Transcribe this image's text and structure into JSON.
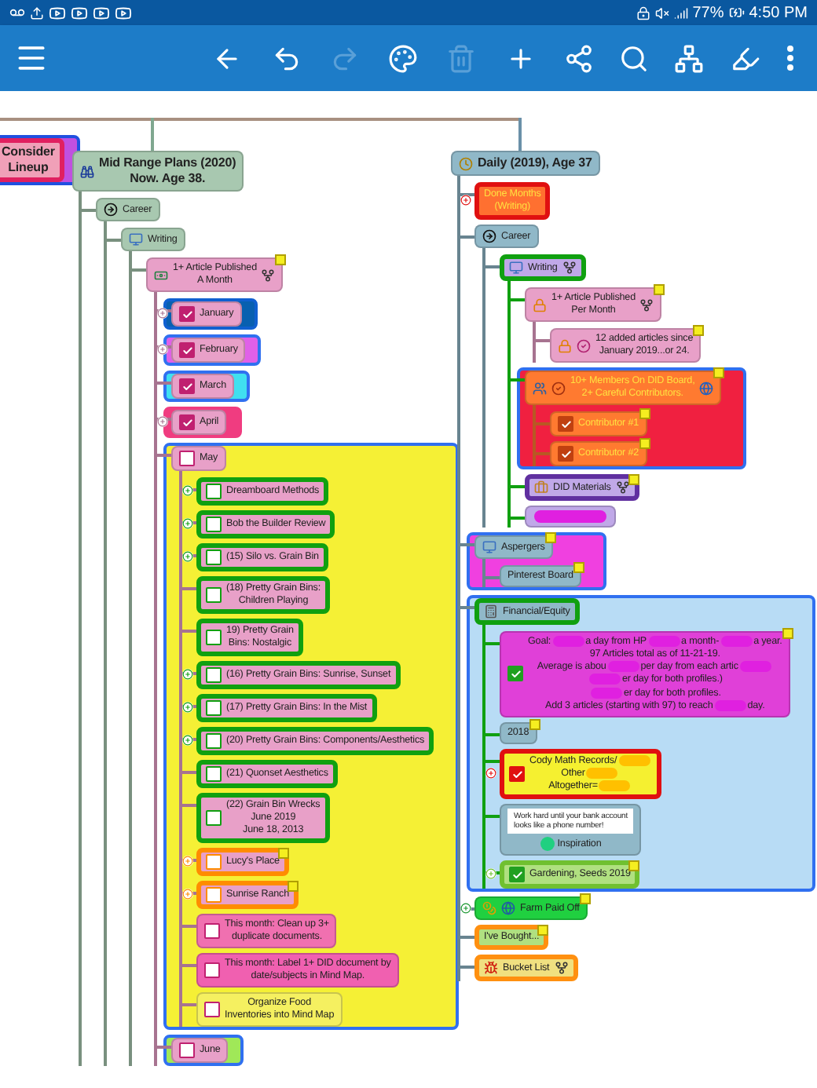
{
  "status_bar": {
    "battery": "77%",
    "time": "4:50 PM"
  },
  "toolbar": {
    "buttons": [
      {
        "disabled": false
      },
      {
        "disabled": false
      },
      {
        "disabled": false
      },
      {
        "disabled": true
      },
      {
        "disabled": false
      },
      {
        "disabled": true
      },
      {
        "disabled": false
      },
      {
        "disabled": false
      },
      {
        "disabled": false
      },
      {
        "disabled": false
      },
      {
        "disabled": false
      },
      {
        "disabled": false
      }
    ]
  },
  "branches": [
    {
      "label": "Consider\nLineup",
      "color": "#f0a0b8",
      "outline": {
        "color": "#e02060"
      },
      "boundary": {
        "color": "#c050e0",
        "edge": {
          "color": "#2050e0"
        }
      }
    },
    {
      "label": "Mid Range Plans (2020)\nNow. Age 38.",
      "color": "#a8c8b0",
      "children": [
        {
          "label": "Career",
          "color": "#a8c8b0",
          "children": [
            {
              "label": "Writing",
              "color": "#a8c8b0",
              "children": [
                {
                  "label": "1+ Article Published\nA Month",
                  "color": "#e8a0c8",
                  "note": true,
                  "linked": true,
                  "children": [
                    {
                      "label": "January",
                      "color": "#e8a0c8",
                      "checkbox": {
                        "color": "#c02070"
                      },
                      "checked": true,
                      "boundary": {
                        "color": "#0860b0",
                        "edge": {
                          "color": "#1060d0"
                        }
                      },
                      "knob": true
                    },
                    {
                      "label": "February",
                      "color": "#e8a0c8",
                      "checkbox": {
                        "color": "#c02070"
                      },
                      "checked": true,
                      "boundary": {
                        "color": "#e060e8",
                        "edge": {
                          "color": "#3070f0"
                        }
                      },
                      "knob": true
                    },
                    {
                      "label": "March",
                      "color": "#e8a0c8",
                      "checkbox": {
                        "color": "#c02070"
                      },
                      "checked": true,
                      "boundary": {
                        "color": "#40e0f0",
                        "edge": {
                          "color": "#3070f0"
                        }
                      }
                    },
                    {
                      "label": "April",
                      "color": "#e8a0c8",
                      "checkbox": {
                        "color": "#c02070"
                      },
                      "checked": true,
                      "boundary": {
                        "color": "#f03c80",
                        "edge": {
                          "color": "#f03c80"
                        }
                      },
                      "knob": true
                    },
                    {
                      "label": "May",
                      "color": "#e8a0c8",
                      "checkbox": {
                        "color": "#c02070"
                      },
                      "checked": false,
                      "boundary": {
                        "color": "#f5f035",
                        "edge": {
                          "color": "#3070f0"
                        }
                      },
                      "children": [
                        {
                          "label": "Dreamboard Methods",
                          "color": "#e8a0c8",
                          "outline": {
                            "color": "#10a010"
                          },
                          "checkbox": {
                            "color": "#10a010"
                          },
                          "checked": false,
                          "knob": true
                        },
                        {
                          "label": "Bob the Builder Review",
                          "color": "#e8a0c8",
                          "outline": {
                            "color": "#10a010"
                          },
                          "checkbox": {
                            "color": "#10a010"
                          },
                          "checked": false,
                          "knob": true
                        },
                        {
                          "label": "(15) Silo vs. Grain Bin",
                          "color": "#e8a0c8",
                          "outline": {
                            "color": "#10a010"
                          },
                          "checkbox": {
                            "color": "#10a010"
                          },
                          "checked": false,
                          "knob": true
                        },
                        {
                          "label": "(18) Pretty Grain Bins:\nChildren Playing",
                          "color": "#e8a0c8",
                          "outline": {
                            "color": "#10a010"
                          },
                          "checkbox": {
                            "color": "#10a010"
                          },
                          "checked": false
                        },
                        {
                          "label": "19) Pretty Grain\nBins: Nostalgic",
                          "color": "#e8a0c8",
                          "outline": {
                            "color": "#10a010"
                          },
                          "checkbox": {
                            "color": "#10a010"
                          },
                          "checked": false
                        },
                        {
                          "label": "(16) Pretty Grain Bins: Sunrise, Sunset",
                          "color": "#e8a0c8",
                          "outline": {
                            "color": "#10a010"
                          },
                          "checkbox": {
                            "color": "#10a010"
                          },
                          "checked": false,
                          "knob": true
                        },
                        {
                          "label": "(17) Pretty Grain Bins: In the Mist",
                          "color": "#e8a0c8",
                          "outline": {
                            "color": "#10a010"
                          },
                          "checkbox": {
                            "color": "#10a010"
                          },
                          "checked": false,
                          "knob": true
                        },
                        {
                          "label": "(20) Pretty Grain Bins: Components/Aesthetics",
                          "color": "#e8a0c8",
                          "outline": {
                            "color": "#10a010"
                          },
                          "checkbox": {
                            "color": "#10a010"
                          },
                          "checked": false,
                          "knob": true
                        },
                        {
                          "label": "(21) Quonset Aesthetics",
                          "color": "#e8a0c8",
                          "outline": {
                            "color": "#10a010"
                          },
                          "checkbox": {
                            "color": "#10a010"
                          },
                          "checked": false
                        },
                        {
                          "label": "(22) Grain Bin Wrecks\nJune 2019\nJune 18, 2013",
                          "color": "#e8a0c8",
                          "outline": {
                            "color": "#10a010"
                          },
                          "checkbox": {
                            "color": "#10a010"
                          },
                          "checked": false
                        },
                        {
                          "label": "Lucy's Place",
                          "color": "#e8a0c8",
                          "outline": {
                            "color": "#ff8c00"
                          },
                          "checkbox": {
                            "color": "#ff8c00"
                          },
                          "checked": false,
                          "note": true,
                          "knob": true
                        },
                        {
                          "label": "Sunrise Ranch",
                          "color": "#e8a0c8",
                          "outline": {
                            "color": "#ff8c00"
                          },
                          "checkbox": {
                            "color": "#ff8c00"
                          },
                          "checked": false,
                          "note": true,
                          "knob": true
                        },
                        {
                          "label": "This month: Clean up 3+\nduplicate documents.",
                          "color": "#f070b0",
                          "checkbox": {
                            "color": "#c02070"
                          },
                          "checked": false
                        },
                        {
                          "label": "This month: Label 1+ DID document by\ndate/subjects in Mind Map.",
                          "color": "#f060b0",
                          "checkbox": {
                            "color": "#c02070"
                          },
                          "checked": false
                        },
                        {
                          "label": "Organize Food\nInventories into Mind Map",
                          "color": "#f5f060",
                          "checkbox": {
                            "color": "#c02070"
                          },
                          "checked": false
                        }
                      ]
                    },
                    {
                      "label": "June",
                      "color": "#e8a0c8",
                      "checkbox": {
                        "color": "#c02070"
                      },
                      "checked": false,
                      "boundary": {
                        "color": "#a0e858",
                        "edge": {
                          "color": "#3070f0"
                        }
                      }
                    }
                  ]
                }
              ]
            }
          ]
        }
      ]
    },
    {
      "label": "Daily (2019), Age 37",
      "color": "#90b8c8",
      "children": [
        {
          "label": "Done Months\n(Writing)",
          "color": "#ff7030",
          "outline": {
            "color": "#e01010"
          },
          "ink": {
            "color": "#ffe040"
          },
          "knob": true
        },
        {
          "label": "Career",
          "color": "#90b8c8",
          "children": [
            {
              "label": "Writing",
              "color": "#c0a8e8",
              "outline": {
                "color": "#10a010"
              },
              "linked": true,
              "children": [
                {
                  "label": "1+ Article Published\nPer Month",
                  "color": "#e8a0c8",
                  "note": true,
                  "linked": true,
                  "children": [
                    {
                      "label": "12 added articles since\nJanuary 2019...or 24.",
                      "color": "#e8a0c8",
                      "note": true
                    }
                  ]
                },
                {
                  "label": "10+ Members On DID Board,\n2+ Careful Contributors.",
                  "color": "#ff7a30",
                  "ink": {
                    "color": "#ffe040"
                  },
                  "boundary": {
                    "color": "#f02040",
                    "edge": {
                      "color": "#3070f0"
                    }
                  },
                  "note": true,
                  "children": [
                    {
                      "label": "Contributor #1",
                      "color": "#ff7a30",
                      "ink": {
                        "color": "#ffe040"
                      },
                      "checkbox": {
                        "color": "#c04010"
                      },
                      "checked": true,
                      "note": true
                    },
                    {
                      "label": "Contributor #2",
                      "color": "#ff7a30",
                      "ink": {
                        "color": "#ffe040"
                      },
                      "checkbox": {
                        "color": "#c04010"
                      },
                      "checked": true,
                      "note": true
                    }
                  ]
                },
                {
                  "label": "DID Materials",
                  "color": "#c0a8e8",
                  "outline": {
                    "color": "#6030a0"
                  },
                  "note": true,
                  "linked": true
                },
                {
                  "color": "#c0a8e8",
                  "scribble": {
                    "color": "#e020e0"
                  }
                }
              ]
            }
          ]
        },
        {
          "label": "Aspergers",
          "color": "#90b8c8",
          "boundary": {
            "color": "#f040e0",
            "edge": {
              "color": "#3070f0"
            }
          },
          "note": true,
          "children": [
            {
              "label": "Pinterest Board",
              "color": "#90b8c8",
              "note": true
            }
          ]
        },
        {
          "label": "Financial/Equity",
          "color": "#90b8c8",
          "outline": {
            "color": "#10a010"
          },
          "boundary": {
            "color": "#b8dcf5",
            "edge": {
              "color": "#3070f0"
            }
          },
          "children": [
            {
              "lines": [
                [
                  {
                    "kind": "text",
                    "text": "Goal:"
                  },
                  {
                    "kind": "scribble"
                  },
                  {
                    "kind": "text",
                    "text": "a day from HP"
                  },
                  {
                    "kind": "scribble"
                  },
                  {
                    "kind": "text",
                    "text": "a month-"
                  },
                  {
                    "kind": "scribble"
                  },
                  {
                    "kind": "text",
                    "text": "a year."
                  }
                ],
                [
                  {
                    "kind": "text",
                    "text": "97 Articles total as of 11-21-19."
                  }
                ],
                [
                  {
                    "kind": "text",
                    "text": "Average is abou"
                  },
                  {
                    "kind": "scribble"
                  },
                  {
                    "kind": "text",
                    "text": "per day from each artic"
                  },
                  {
                    "kind": "scribble"
                  }
                ],
                [
                  {
                    "kind": "scribble"
                  },
                  {
                    "kind": "text",
                    "text": "er day for both profiles.)"
                  }
                ],
                [
                  {
                    "kind": "scribble"
                  },
                  {
                    "kind": "text",
                    "text": "er day for both profiles."
                  }
                ],
                [
                  {
                    "kind": "text",
                    "text": "Add 3 articles (starting with 97) to reach"
                  },
                  {
                    "kind": "scribble"
                  },
                  {
                    "kind": "text",
                    "text": "day."
                  }
                ]
              ],
              "color": "#e040d8",
              "scribble": {
                "color": "#e020e0"
              },
              "checkbox": {
                "color": "#20a020"
              },
              "checked": true,
              "note": true
            },
            {
              "label": "2018",
              "color": "#90b8c8",
              "note": true
            },
            {
              "lines": [
                [
                  {
                    "kind": "text",
                    "text": "Cody Math Records/"
                  },
                  {
                    "kind": "scribble"
                  }
                ],
                [
                  {
                    "kind": "text",
                    "text": "Other"
                  },
                  {
                    "kind": "scribble"
                  }
                ],
                [
                  {
                    "kind": "text",
                    "text": "Altogether="
                  },
                  {
                    "kind": "scribble"
                  }
                ]
              ],
              "color": "#f5f030",
              "outline": {
                "color": "#e01010"
              },
              "scribble": {
                "color": "#ffc000"
              },
              "checkbox": {
                "color": "#e01010"
              },
              "checked": true,
              "knob": true
            },
            {
              "quote": "Work hard until your bank account\nlooks like a phone number!",
              "label": "Inspiration",
              "color": "#90b8c8"
            },
            {
              "label": "Gardening, Seeds 2019",
              "color": "#b0e080",
              "outline": {
                "color": "#70c030"
              },
              "checkbox": {
                "color": "#20a020"
              },
              "checked": true,
              "note": true,
              "knob": true
            }
          ]
        },
        {
          "label": "Farm Paid Off",
          "color": "#20d040",
          "note": true,
          "knob": true
        },
        {
          "label": "I've Bought...",
          "color": "#b0e080",
          "outline": {
            "color": "#ff9010"
          },
          "note": true
        },
        {
          "label": "Bucket List",
          "color": "#f0e080",
          "outline": {
            "color": "#ff9010"
          },
          "linked": true
        }
      ]
    }
  ]
}
